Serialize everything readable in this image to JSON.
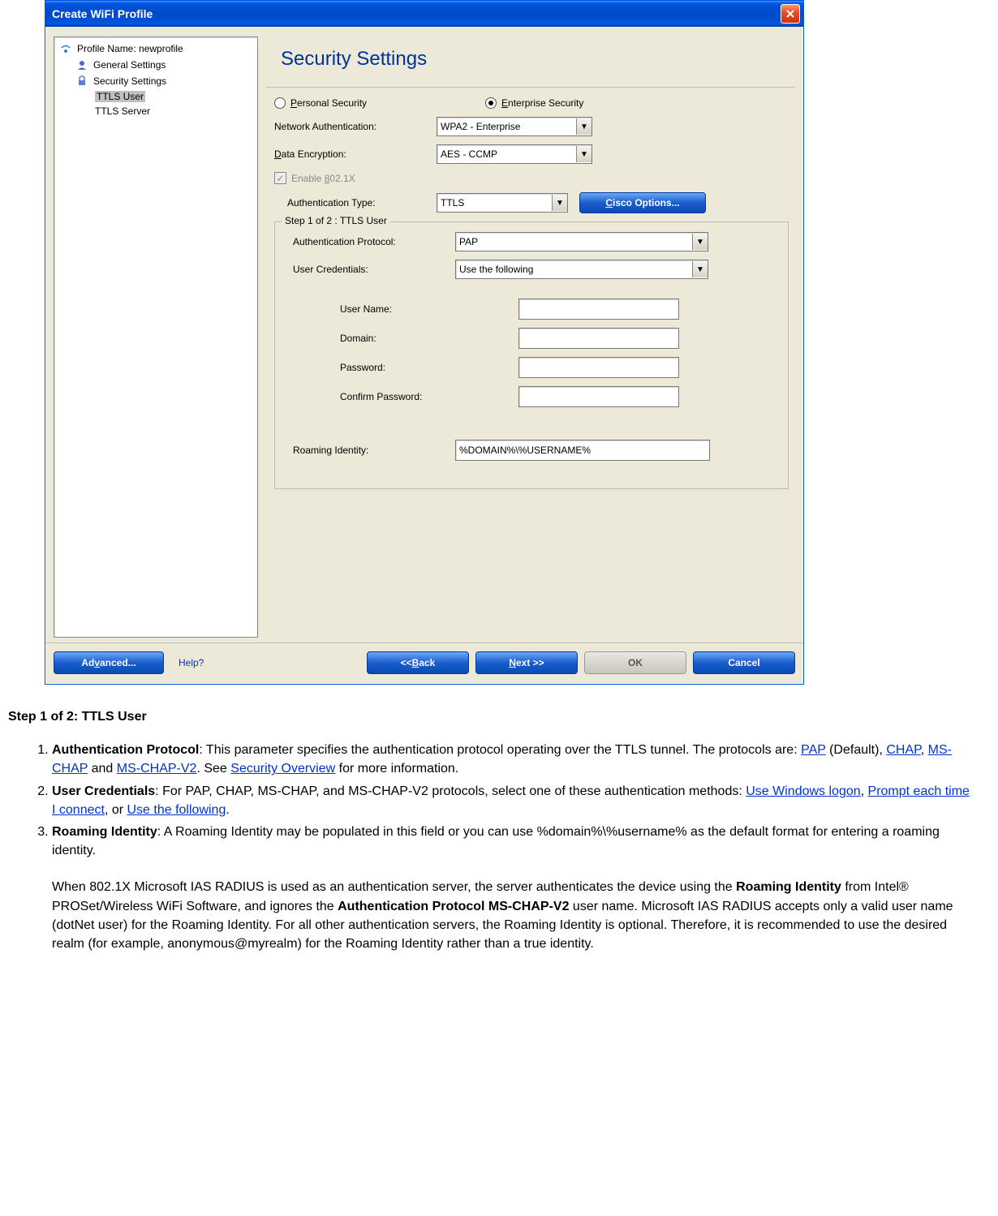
{
  "dialog": {
    "title": "Create WiFi Profile",
    "sidebar": {
      "items": [
        {
          "label": "Profile Name: newprofile",
          "icon": "wifi-icon"
        },
        {
          "label": "General Settings",
          "icon": "user-icon"
        },
        {
          "label": "Security Settings",
          "icon": "lock-icon"
        },
        {
          "label": "TTLS User",
          "icon": "",
          "selected": true
        },
        {
          "label": "TTLS Server",
          "icon": ""
        }
      ]
    },
    "heading": "Security Settings",
    "security_mode": {
      "personal": "Personal Security",
      "enterprise": "Enterprise Security",
      "selected": "enterprise"
    },
    "fields": {
      "net_auth_label": "Network Authentication:",
      "net_auth_value": "WPA2 - Enterprise",
      "data_enc_label": "Data Encryption:",
      "data_enc_value": "AES - CCMP",
      "enable_8021x_label": "Enable 802.1X",
      "auth_type_label": "Authentication Type:",
      "auth_type_value": "TTLS",
      "cisco_btn": "Cisco Options..."
    },
    "step": {
      "legend": "Step 1 of 2 : TTLS User",
      "auth_proto_label": "Authentication Protocol:",
      "auth_proto_value": "PAP",
      "user_cred_label": "User Credentials:",
      "user_cred_value": "Use the following",
      "username_label": "User Name:",
      "username_value": "",
      "domain_label": "Domain:",
      "domain_value": "",
      "password_label": "Password:",
      "password_value": "",
      "confirm_label": "Confirm Password:",
      "confirm_value": "",
      "roaming_label": "Roaming Identity:",
      "roaming_value": "%DOMAIN%\\%USERNAME%"
    },
    "footer": {
      "advanced": "Advanced...",
      "help": "Help?",
      "back": "<< Back",
      "next": "Next >>",
      "ok": "OK",
      "cancel": "Cancel"
    }
  },
  "doc": {
    "heading": "Step 1 of 2: TTLS User",
    "items": [
      {
        "strong": "Authentication Protocol",
        "text1": ": This parameter specifies the authentication protocol operating over the TTLS tunnel. The protocols are: ",
        "link1": "PAP",
        "text2": " (Default), ",
        "link2": "CHAP",
        "text3": ", ",
        "link3": "MS-CHAP",
        "text4": " and ",
        "link4": "MS-CHAP-V2",
        "text5": ". See ",
        "link5": "Security Overview",
        "text6": " for more information."
      },
      {
        "strong": "User Credentials",
        "text1": ": For PAP, CHAP, MS-CHAP, and MS-CHAP-V2 protocols, select one of these authentication methods: ",
        "link1": "Use Windows logon",
        "text2": ", ",
        "link2": "Prompt each time I connect",
        "text3": ", or ",
        "link3": "Use the following",
        "text4": "."
      },
      {
        "strong": "Roaming Identity",
        "text1": ": A Roaming Identity may be populated in this field or you can use %domain%\\%username% as the default format for entering a roaming identity.",
        "para": "When 802.1X Microsoft IAS RADIUS is used as an authentication server, the server authenticates the device using the ",
        "parastrong1": "Roaming Identity",
        "para2": " from Intel® PROSet/Wireless WiFi Software, and ignores the ",
        "parastrong2": "Authentication Protocol MS-CHAP-V2",
        "para3": " user name. Microsoft IAS RADIUS accepts only a valid user name (dotNet user) for the Roaming Identity. For all other authentication servers, the Roaming Identity is optional. Therefore, it is recommended to use the desired realm (for example, anonymous@myrealm) for the Roaming Identity rather than a true identity."
      }
    ]
  }
}
